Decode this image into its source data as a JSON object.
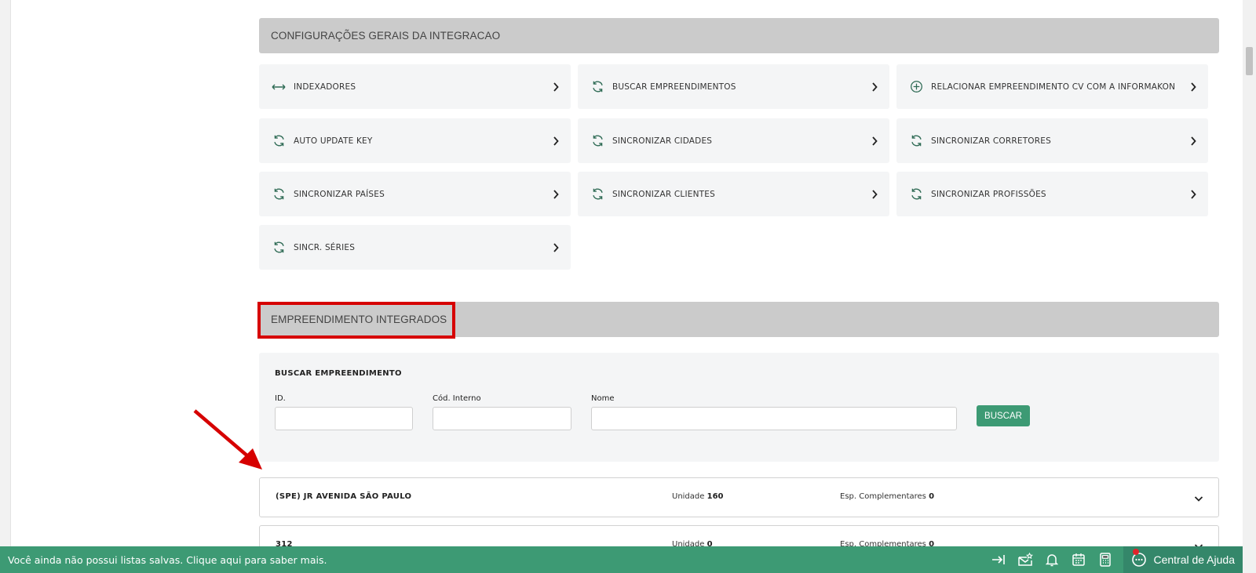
{
  "sections": {
    "general_title": "CONFIGURAÇÕES GERAIS DA INTEGRACAO",
    "integrated_title": "EMPREENDIMENTO INTEGRADOS"
  },
  "actions": [
    {
      "label": "INDEXADORES",
      "icon": "arrows-horizontal-icon"
    },
    {
      "label": "BUSCAR EMPREENDIMENTOS",
      "icon": "sync-icon"
    },
    {
      "label": "RELACIONAR EMPREENDIMENTO CV COM A INFORMAKON",
      "icon": "plus-circle-icon"
    },
    {
      "label": "AUTO UPDATE KEY",
      "icon": "sync-icon"
    },
    {
      "label": "SINCRONIZAR CIDADES",
      "icon": "sync-icon"
    },
    {
      "label": "SINCRONIZAR CORRETORES",
      "icon": "sync-icon"
    },
    {
      "label": "SINCRONIZAR PAÍSES",
      "icon": "sync-icon"
    },
    {
      "label": "SINCRONIZAR CLIENTES",
      "icon": "sync-icon"
    },
    {
      "label": "SINCRONIZAR PROFISSÕES",
      "icon": "sync-icon"
    },
    {
      "label": "SINCR. SÉRIES",
      "icon": "sync-icon"
    }
  ],
  "search": {
    "title": "BUSCAR EMPREENDIMENTO",
    "id_label": "ID.",
    "id_value": "",
    "code_label": "Cód. Interno",
    "code_value": "",
    "name_label": "Nome",
    "name_value": "",
    "button": "BUSCAR"
  },
  "results": [
    {
      "name": "(SPE) JR AVENIDA SÃO PAULO",
      "unit_label": "Unidade",
      "unit_value": "160",
      "esp_label": "Esp. Complementares",
      "esp_value": "0"
    },
    {
      "name": "312",
      "unit_label": "Unidade",
      "unit_value": "0",
      "esp_label": "Esp. Complementares",
      "esp_value": "0"
    }
  ],
  "footer": {
    "message": "Você ainda não possui listas salvas. Clique aqui para saber mais.",
    "help_label": "Central de Ajuda",
    "icons": [
      "arrow-to-right-icon",
      "mail-star-icon",
      "bell-icon",
      "calendar-icon",
      "calculator-icon"
    ]
  },
  "colors": {
    "accent": "#3d9a74",
    "highlight": "#d60000",
    "header_bg": "#cbcbcb"
  }
}
